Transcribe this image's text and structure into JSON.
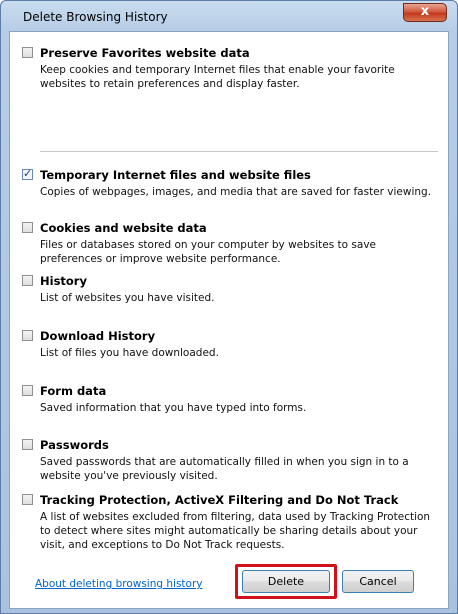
{
  "window": {
    "title": "Delete Browsing History",
    "close_label": "x"
  },
  "items": [
    {
      "label": "Preserve Favorites website data",
      "desc": "Keep cookies and temporary Internet files that enable your favorite websites to retain preferences and display faster.",
      "checked": false
    },
    {
      "label": "Temporary Internet files and website files",
      "desc": "Copies of webpages, images, and media that are saved for faster viewing.",
      "checked": true
    },
    {
      "label": "Cookies and website data",
      "desc": "Files or databases stored on your computer by websites to save preferences or improve website performance.",
      "checked": false
    },
    {
      "label": "History",
      "desc": "List of websites you have visited.",
      "checked": false
    },
    {
      "label": "Download History",
      "desc": "List of files you have downloaded.",
      "checked": false
    },
    {
      "label": "Form data",
      "desc": "Saved information that you have typed into forms.",
      "checked": false
    },
    {
      "label": "Passwords",
      "desc": "Saved passwords that are automatically filled in when you sign in to a website you've previously visited.",
      "checked": false
    },
    {
      "label": "Tracking Protection, ActiveX Filtering and Do Not Track",
      "desc": "A list of websites excluded from filtering, data used by Tracking Protection to detect where sites might automatically be sharing details about your visit, and exceptions to Do Not Track requests.",
      "checked": false
    }
  ],
  "footer": {
    "link_label": "About deleting browsing history",
    "delete_label": "Delete",
    "cancel_label": "Cancel"
  },
  "colors": {
    "highlight": "#d0101a",
    "link": "#0066cc",
    "accent": "#1d3f86"
  }
}
